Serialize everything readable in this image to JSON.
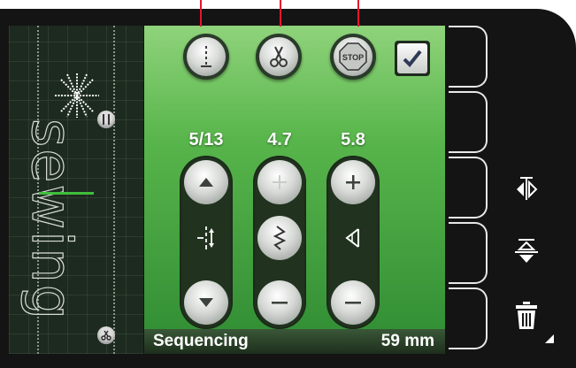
{
  "preview": {
    "stitch_text": "sewing"
  },
  "top_buttons": [
    {
      "name": "tie-off-button",
      "icon": "tie-off-icon"
    },
    {
      "name": "thread-cut-button",
      "icon": "scissors-icon"
    },
    {
      "name": "stop-button",
      "icon": "stop-sign-icon",
      "label": "STOP"
    },
    {
      "name": "confirm-button",
      "icon": "checkmark-icon"
    }
  ],
  "controls": [
    {
      "value": "5/13",
      "name": "sequence-position",
      "mid_icon": "stitch-position-icon"
    },
    {
      "value": "4.7",
      "name": "stitch-length",
      "mid_icon": "stitch-zigzag-icon"
    },
    {
      "value": "5.8",
      "name": "stitch-width",
      "mid_icon": "width-wedge-icon"
    }
  ],
  "status": {
    "mode": "Sequencing",
    "length": "59 mm"
  },
  "side_icons": [
    "mirror-side-to-side-icon",
    "mirror-end-to-end-icon",
    "trash-icon"
  ],
  "colors": {
    "pointer": "#e5162e",
    "screen_green": "#58b54b",
    "needle_line": "#3fbe3c"
  }
}
